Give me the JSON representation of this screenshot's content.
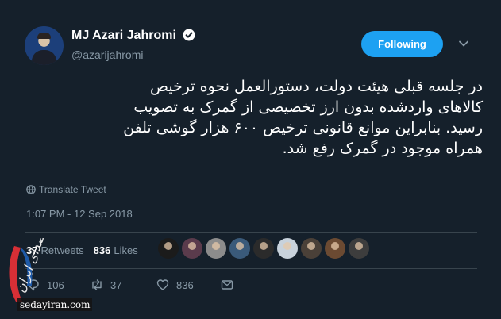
{
  "tweet": {
    "author": {
      "name": "MJ Azari Jahromi",
      "handle": "@azarijahromi",
      "verified": true
    },
    "follow_button_label": "Following",
    "text_lines": [
      "در جلسه قبلی هیئت دولت، دستورالعمل نحوه ترخیص",
      "کالاهای وارد‌شده بدون ارز تخصیصی از گمرک به تصویب",
      "رسید. بنابراین موانع قانونی ترخیص ۶۰۰ هزار گوشی تلفن",
      "همراه موجود در گمرک رفع شد."
    ],
    "translate_label": "Translate Tweet",
    "timestamp": "1:07 PM - 12 Sep 2018",
    "stats": {
      "retweets_count": "37",
      "retweets_label": "Retweets",
      "likes_count": "836",
      "likes_label": "Likes"
    },
    "liker_avatars": [
      "liker-1",
      "liker-2",
      "liker-3",
      "liker-4",
      "liker-5",
      "liker-6",
      "liker-7",
      "liker-8",
      "liker-9"
    ],
    "actions": {
      "replies": "106",
      "retweets": "37",
      "likes": "836"
    }
  },
  "watermark": {
    "site": "sedayiran.com",
    "logo_text": "صدای ایران"
  },
  "colors": {
    "background": "#15202b",
    "accent": "#1da1f2",
    "muted": "#8899a6",
    "divider": "#38444d"
  }
}
